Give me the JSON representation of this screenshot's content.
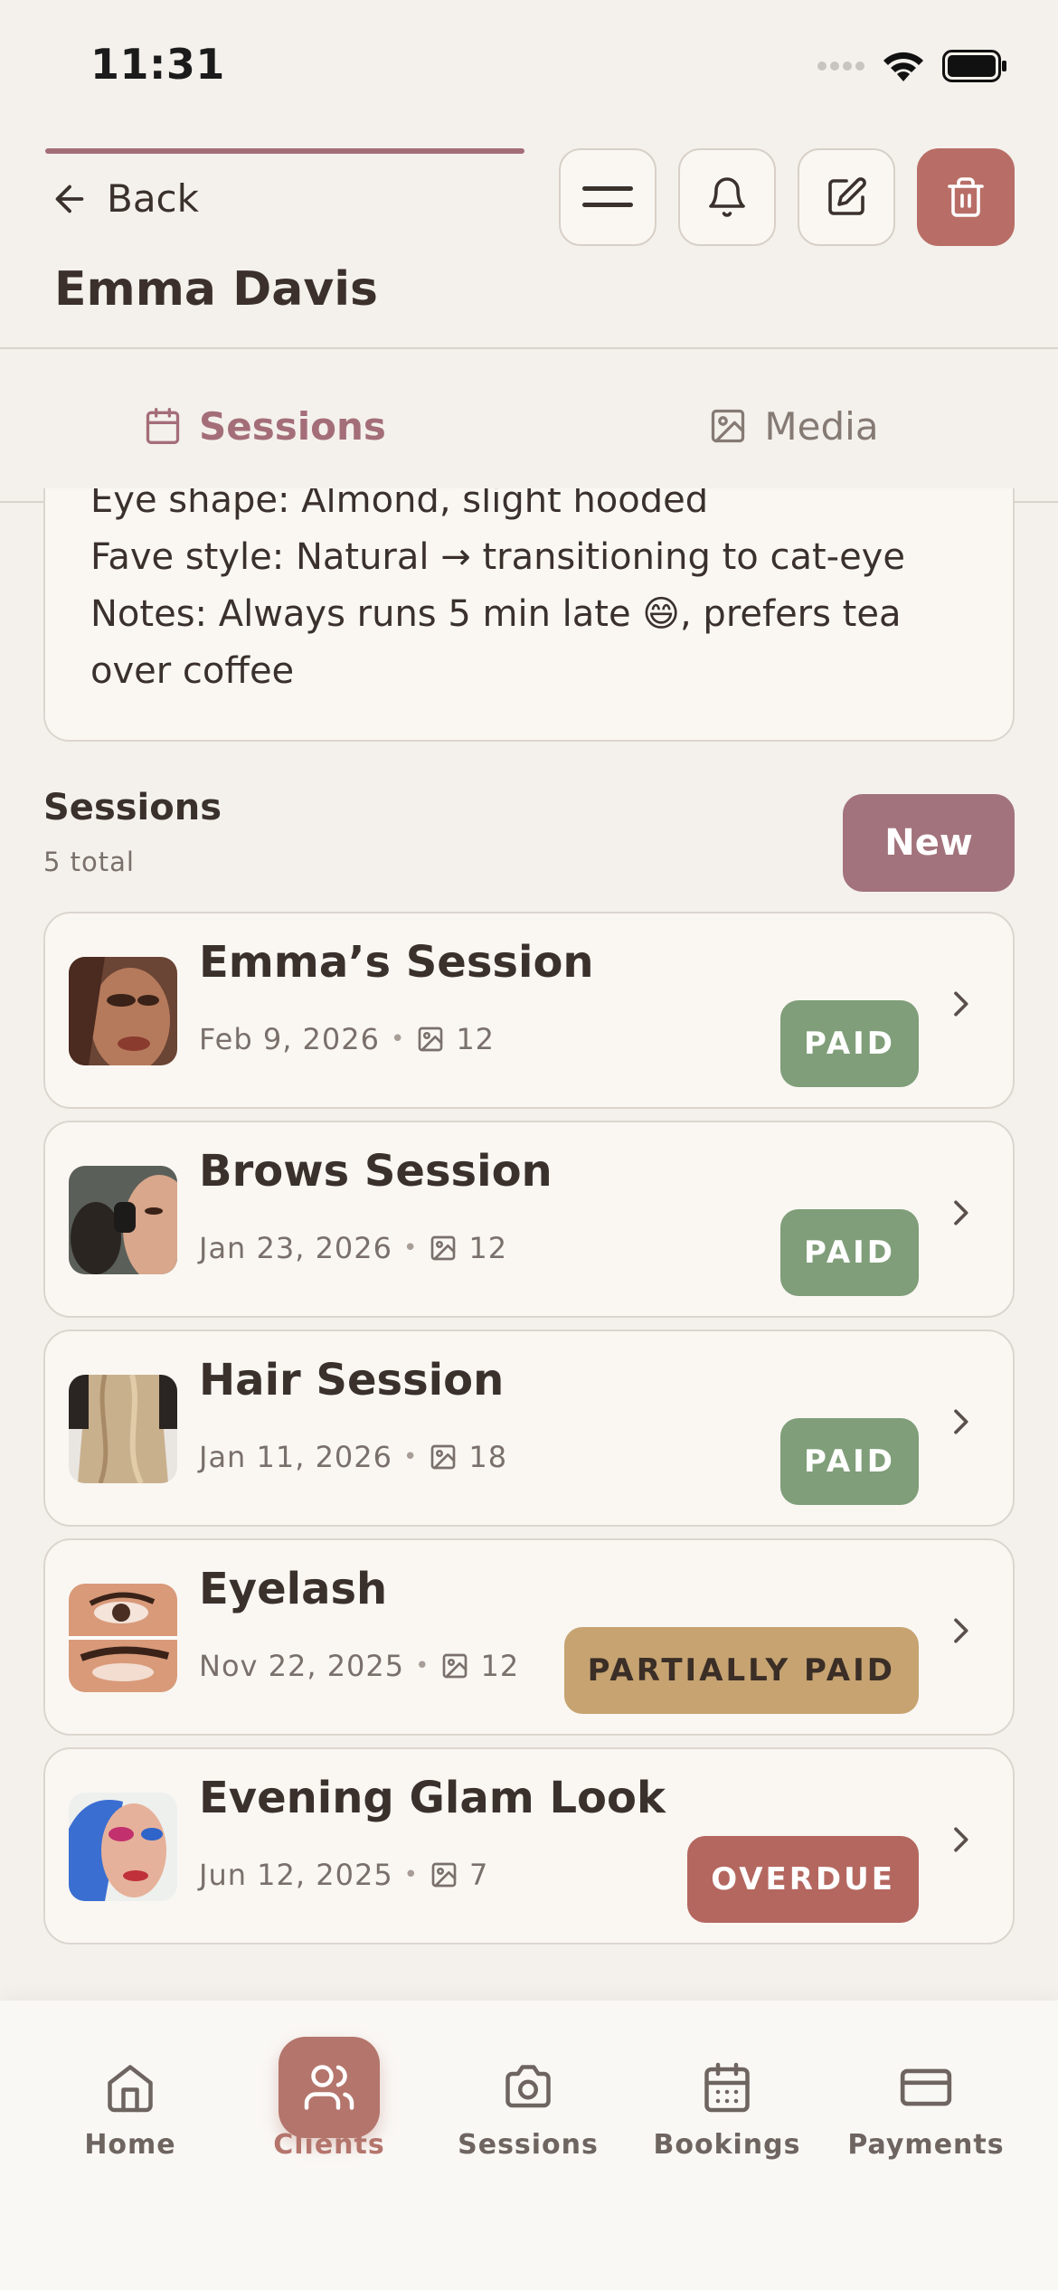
{
  "status_bar": {
    "time": "11:31"
  },
  "header": {
    "back_label": "Back",
    "client_name": "Emma Davis",
    "buttons": [
      "menu-icon",
      "bell-icon",
      "edit-icon",
      "trash-icon"
    ]
  },
  "tabs": [
    {
      "label": "Sessions",
      "icon": "calendar-icon",
      "active": true
    },
    {
      "label": "Media",
      "icon": "image-icon",
      "active": false
    }
  ],
  "notes": {
    "lines": [
      "Eye shape: Almond, slight hooded",
      "Fave style: Natural → transitioning to cat-eye",
      "Notes: Always runs 5 min late 😄, prefers tea",
      "over coffee"
    ]
  },
  "sessions_section": {
    "title": "Sessions",
    "count": "5 total",
    "new_label": "New",
    "items": [
      {
        "name": "Emma’s Session",
        "date": "Feb 9, 2026",
        "media_count": "12",
        "status": "PAID",
        "status_type": "paid"
      },
      {
        "name": "Brows Session",
        "date": "Jan 23, 2026",
        "media_count": "12",
        "status": "PAID",
        "status_type": "paid"
      },
      {
        "name": "Hair Session",
        "date": "Jan 11, 2026",
        "media_count": "18",
        "status": "PAID",
        "status_type": "paid"
      },
      {
        "name": "Eyelash",
        "date": "Nov 22, 2025",
        "media_count": "12",
        "status": "PARTIALLY PAID",
        "status_type": "partial"
      },
      {
        "name": "Evening Glam Look",
        "date": "Jun 12, 2025",
        "media_count": "7",
        "status": "OVERDUE",
        "status_type": "overdue"
      }
    ]
  },
  "bottom_nav": [
    {
      "label": "Home",
      "icon": "home-icon",
      "active": false
    },
    {
      "label": "Clients",
      "icon": "users-icon",
      "active": true
    },
    {
      "label": "Sessions",
      "icon": "camera-icon",
      "active": false
    },
    {
      "label": "Bookings",
      "icon": "calendar-icon",
      "active": false
    },
    {
      "label": "Payments",
      "icon": "credit-card-icon",
      "active": false
    }
  ],
  "colors": {
    "accent": "#a46e79",
    "delete": "#b86e66",
    "paid": "#7f9e79",
    "partial": "#c6a371",
    "overdue": "#b4675f",
    "background": "#f4f1ec"
  }
}
